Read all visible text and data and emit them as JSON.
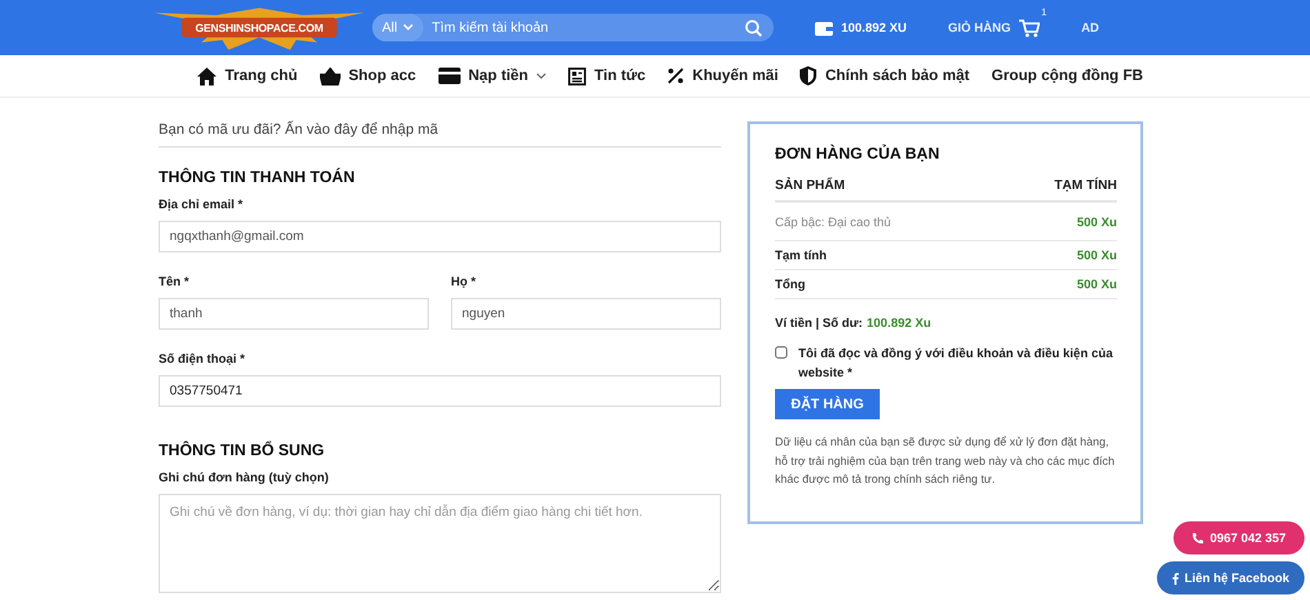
{
  "header": {
    "logo_text": "GENSHINSHOPACE.COM",
    "search_scope": "All",
    "search_placeholder": "Tìm kiếm tài khoản",
    "balance": "100.892 XU",
    "cart_label": "GIỎ HÀNG",
    "cart_count": "1",
    "account": "AD"
  },
  "nav": [
    {
      "label": "Trang chủ",
      "dropdown": false
    },
    {
      "label": "Shop acc",
      "dropdown": false
    },
    {
      "label": "Nạp tiền",
      "dropdown": true
    },
    {
      "label": "Tin tức",
      "dropdown": false
    },
    {
      "label": "Khuyến mãi",
      "dropdown": false
    },
    {
      "label": "Chính sách bảo mật",
      "dropdown": false
    },
    {
      "label": "Group cộng đồng FB",
      "dropdown": false
    }
  ],
  "coupon_prompt": "Bạn có mã ưu đãi? Ấn vào đây để nhập mã",
  "billing": {
    "title": "THÔNG TIN THANH TOÁN",
    "email_label": "Địa chỉ email *",
    "email": "ngqxthanh@gmail.com",
    "first_name_label": "Tên *",
    "first_name": "thanh",
    "last_name_label": "Họ *",
    "last_name": "nguyen",
    "phone_label": "Số điện thoại *",
    "phone": "0357750471"
  },
  "additional": {
    "title": "THÔNG TIN BỔ SUNG",
    "notes_label": "Ghi chú đơn hàng (tuỳ chọn)",
    "notes_placeholder": "Ghi chú về đơn hàng, ví dụ: thời gian hay chỉ dẫn địa điểm giao hàng chi tiết hơn."
  },
  "order": {
    "title": "ĐƠN HÀNG CỦA BẠN",
    "columns": [
      "SẢN PHẨM",
      "TẠM TÍNH"
    ],
    "rows": [
      {
        "kind": "item",
        "label": "Cấp bậc: Đại cao thủ",
        "value": "500 Xu"
      },
      {
        "kind": "total",
        "label": "Tạm tính",
        "value": "500 Xu"
      },
      {
        "kind": "total",
        "label": "Tổng",
        "value": "500 Xu"
      }
    ],
    "wallet_label": "Ví tiền | Số dư:",
    "wallet_balance": "100.892 Xu",
    "terms": {
      "label": "Tôi đã đọc và đồng ý với điều khoản và điều kiện của website *",
      "checked": false
    },
    "submit": "ĐẶT HÀNG",
    "privacy": "Dữ liệu cá nhân của bạn sẽ được sử dụng để xử lý đơn đặt hàng, hỗ trợ trải nghiệm của bạn trên trang web này và cho các mục đích khác được mô tả trong chính sách riêng tư."
  },
  "floating": [
    {
      "kind": "phone",
      "label": "0967 042 357"
    },
    {
      "kind": "facebook",
      "label": "Liên hệ Facebook"
    }
  ]
}
